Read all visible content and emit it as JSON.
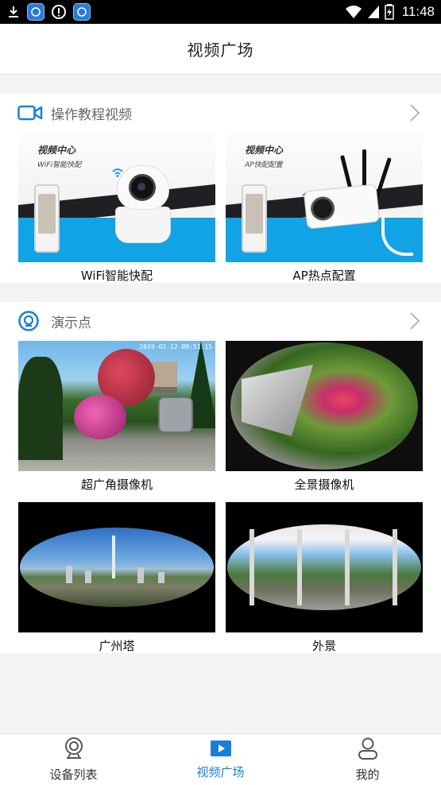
{
  "status_bar": {
    "time": "11:48",
    "left_icons": [
      "download-icon",
      "app-icon",
      "alert-icon",
      "app-icon"
    ],
    "right_icons": [
      "wifi-icon",
      "signal-icon",
      "battery-icon"
    ]
  },
  "header": {
    "title": "视频广场"
  },
  "tutorial_section": {
    "title": "操作教程视频",
    "icon": "video-camera-icon",
    "items": [
      {
        "caption": "WiFi智能快配",
        "thumb_title": "视频中心",
        "thumb_subtitle": "WiFi智能快配"
      },
      {
        "caption": "AP热点配置",
        "thumb_title": "视频中心",
        "thumb_subtitle": "AP快配配置"
      }
    ]
  },
  "demo_section": {
    "title": "演示点",
    "icon": "location-pin-icon",
    "items": [
      {
        "caption": "超广角摄像机",
        "timestamp": "2019-02-12 09:51:15"
      },
      {
        "caption": "全景摄像机"
      },
      {
        "caption": "广州塔"
      },
      {
        "caption": "外景"
      }
    ]
  },
  "bottom_nav": {
    "items": [
      {
        "label": "设备列表",
        "icon": "webcam-icon",
        "active": false
      },
      {
        "label": "视频广场",
        "icon": "play-video-icon",
        "active": true
      },
      {
        "label": "我的",
        "icon": "user-icon",
        "active": false
      }
    ]
  },
  "colors": {
    "accent": "#1a7fd6",
    "background": "#f3f3f3",
    "status_bar": "#000000"
  }
}
